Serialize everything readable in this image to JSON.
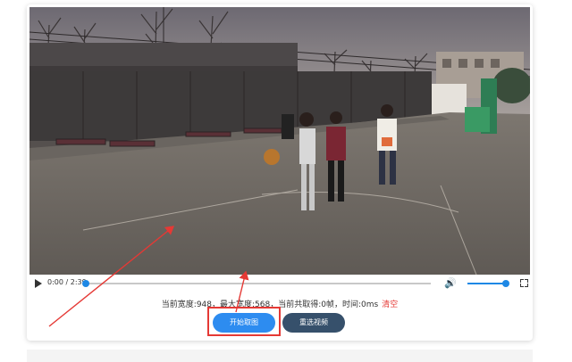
{
  "video": {
    "time_display": "0:00 / 2:39",
    "progress_fraction": 0,
    "volume_fraction": 1
  },
  "status": {
    "text": "当前宽度:948，最大宽度:568，当前共取得:0帧，时间:0ms",
    "clear_label": "清空"
  },
  "buttons": {
    "start_label": "开始取图",
    "reselect_label": "重选视频"
  },
  "colors": {
    "accent": "#2d8cf0",
    "secondary": "#36506b",
    "danger": "#e53935",
    "annotation": "#e53935"
  },
  "icons": [
    "play-icon",
    "volume-icon",
    "fullscreen-icon"
  ]
}
